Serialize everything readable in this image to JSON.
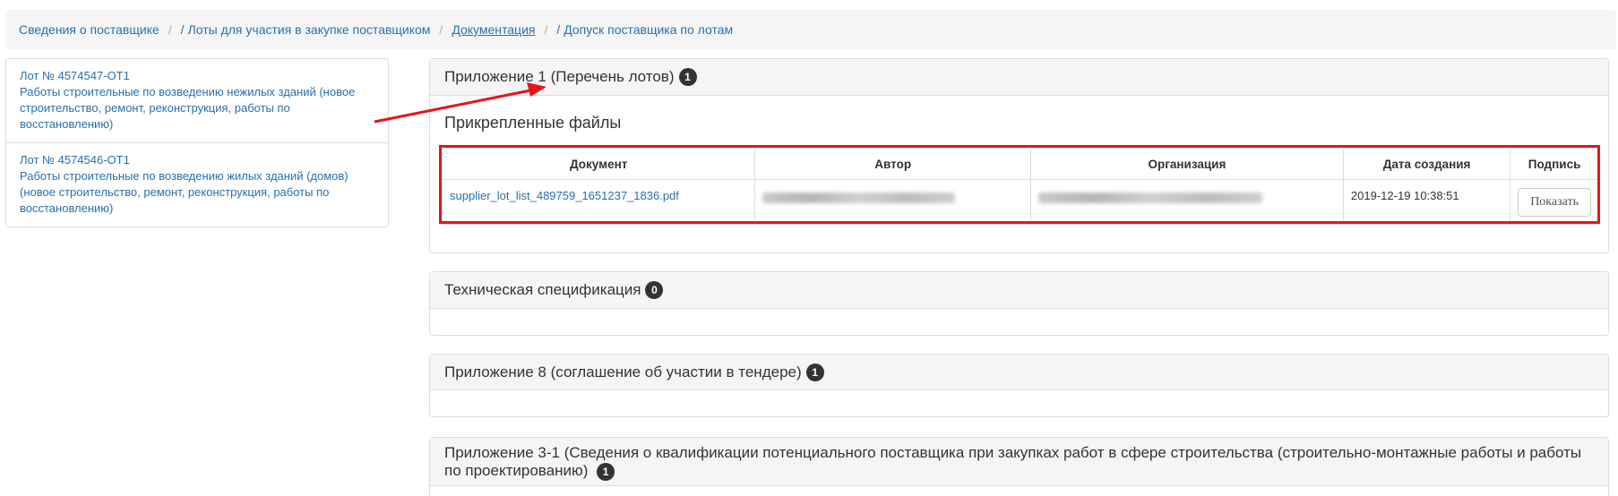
{
  "breadcrumb": {
    "items": [
      {
        "label": "Сведения о поставщике"
      },
      {
        "label": "Лоты для участия в закупке поставщиком"
      },
      {
        "label": "Документация"
      },
      {
        "label": "Допуск поставщика по лотам"
      }
    ],
    "separator": "/"
  },
  "lots": [
    {
      "number": "Лот № 4574547-ОТ1",
      "description": "Работы строительные по возведению нежилых зданий (новое строительство, ремонт, реконструкция, работы по восстановлению)"
    },
    {
      "number": "Лот № 4574546-ОТ1",
      "description": "Работы строительные по возведению жилых зданий (домов) (новое строительство, ремонт, реконструкция, работы по восстановлению)"
    }
  ],
  "panels": [
    {
      "title": "Приложение 1 (Перечень лотов)",
      "count": "1"
    },
    {
      "title": "Техническая спецификация",
      "count": "0"
    },
    {
      "title": "Приложение 8 (соглашение об участии в тендере)",
      "count": "1"
    },
    {
      "title": "Приложение 3-1 (Сведения о квалификации потенциального поставщика при закупках работ в сфере строительства (строительно-монтажные работы и работы по проектированию)",
      "count": "1"
    }
  ],
  "attached": {
    "title": "Прикрепленные файлы",
    "columns": [
      "Документ",
      "Автор",
      "Организация",
      "Дата создания",
      "Подпись"
    ],
    "rows": [
      {
        "document": "supplier_lot_list_489759_1651237_1836.pdf",
        "created": "2019-12-19 10:38:51",
        "action": "Показать"
      }
    ]
  },
  "colors": {
    "link": "#2a6fac",
    "annotation": "#e8141b",
    "badge": "#333333"
  }
}
